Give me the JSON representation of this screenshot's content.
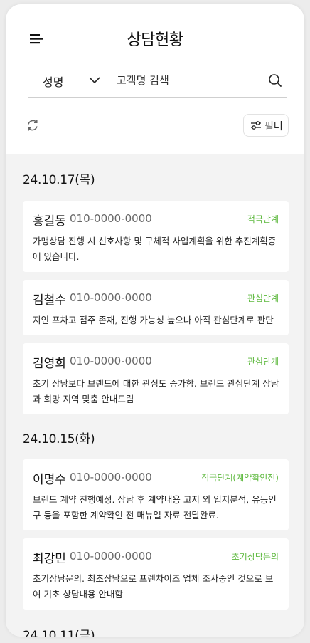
{
  "header": {
    "title": "상담현황",
    "search": {
      "field_selected": "성명",
      "placeholder": "고객명 검색",
      "value": ""
    },
    "filter_label": "필터"
  },
  "colors": {
    "stage_green": "#5cb83c",
    "list_background": "#f3f3f3",
    "card_background": "#ffffff"
  },
  "groups": [
    {
      "date": "24.10.17(목)",
      "items": [
        {
          "name": "홍길동",
          "phone": "010-0000-0000",
          "stage": "적극단계",
          "memo": "가맹상담 진행 시 선호사항 및 구체적 사업계획을 위한 추진계획중에 있습니다."
        },
        {
          "name": "김철수",
          "phone": "010-0000-0000",
          "stage": "관심단계",
          "memo": "지인 프차고 점주 존재, 진행 가능성 높으나 아직 관심단계로 판단"
        },
        {
          "name": "김영희",
          "phone": "010-0000-0000",
          "stage": "관심단계",
          "memo": "초기 상담보다 브랜드에 대한 관심도 증가함. 브랜드 관심단계 상담과 희망 지역 맞춤 안내드림"
        }
      ]
    },
    {
      "date": "24.10.15(화)",
      "items": [
        {
          "name": "이명수",
          "phone": "010-0000-0000",
          "stage": "적극단계(계약확인전)",
          "memo": "브랜드 계약 진행예정. 상담 후 계약내용 고지 외 입지분석, 유동인구 등을 포함한 계약확인 전 매뉴얼 자료 전달완료."
        },
        {
          "name": "최강민",
          "phone": "010-0000-0000",
          "stage": "초기상담문의",
          "memo": "초기상담문의. 최초상담으로 프렌차이즈 업체 조사중인 것으로 보여 기초 상담내용 안내함"
        }
      ]
    },
    {
      "date": "24.10.11(금)",
      "items": []
    }
  ]
}
